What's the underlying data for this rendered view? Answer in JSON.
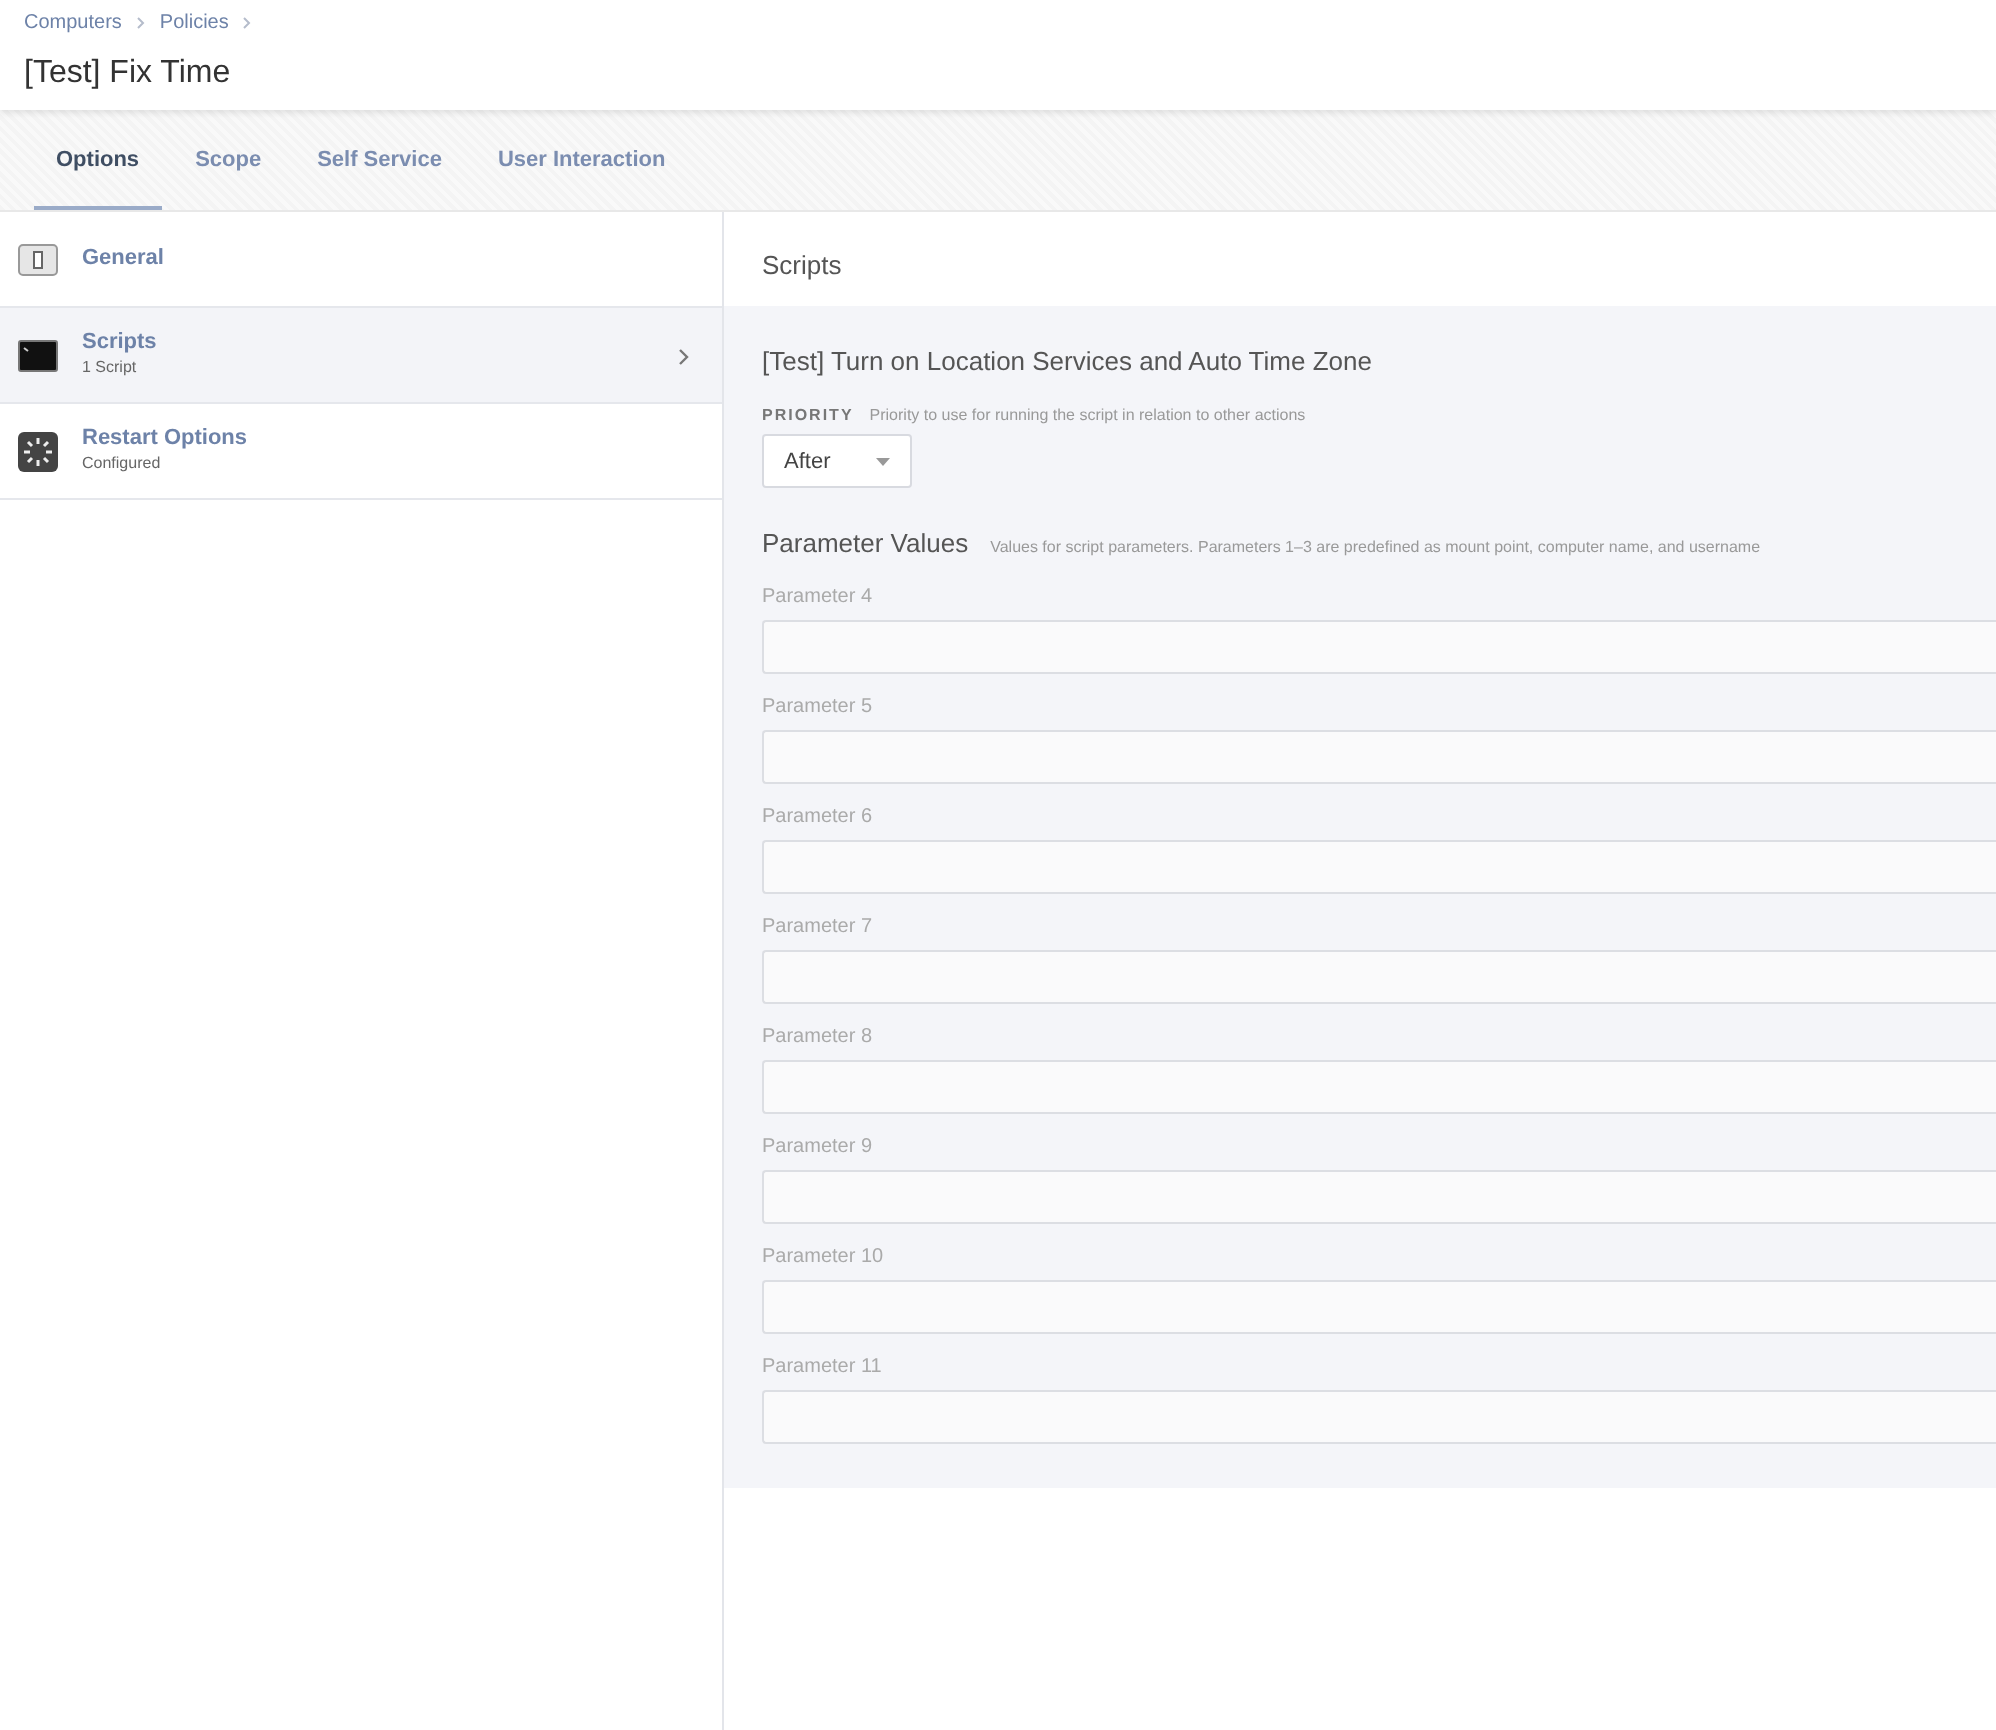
{
  "breadcrumbs": [
    "Computers",
    "Policies"
  ],
  "title": "[Test] Fix Time",
  "tabs": [
    {
      "label": "Options",
      "selected": true
    },
    {
      "label": "Scope",
      "selected": false
    },
    {
      "label": "Self Service",
      "selected": false
    },
    {
      "label": "User Interaction",
      "selected": false
    }
  ],
  "sidebar": {
    "items": [
      {
        "kind": "switch",
        "label": "General",
        "selected": false
      },
      {
        "kind": "terminal",
        "label": "Scripts",
        "subtitle": "1 Script",
        "selected": true
      },
      {
        "kind": "restart",
        "label": "Restart Options",
        "subtitle": "Configured",
        "selected": false
      }
    ]
  },
  "panel": {
    "heading": "Scripts",
    "script_name": "[Test] Turn on Location Services and Auto Time Zone",
    "priority": {
      "label": "PRIORITY",
      "hint": "Priority to use for running the script in relation to other actions",
      "value": "After"
    },
    "parameters": {
      "heading": "Parameter Values",
      "hint": "Values for script parameters. Parameters 1–3 are predefined as mount point, computer name, and username",
      "fields": [
        {
          "label": "Parameter 4"
        },
        {
          "label": "Parameter 5"
        },
        {
          "label": "Parameter 6"
        },
        {
          "label": "Parameter 7"
        },
        {
          "label": "Parameter 8"
        },
        {
          "label": "Parameter 9"
        },
        {
          "label": "Parameter 10"
        },
        {
          "label": "Parameter 11"
        }
      ]
    }
  }
}
